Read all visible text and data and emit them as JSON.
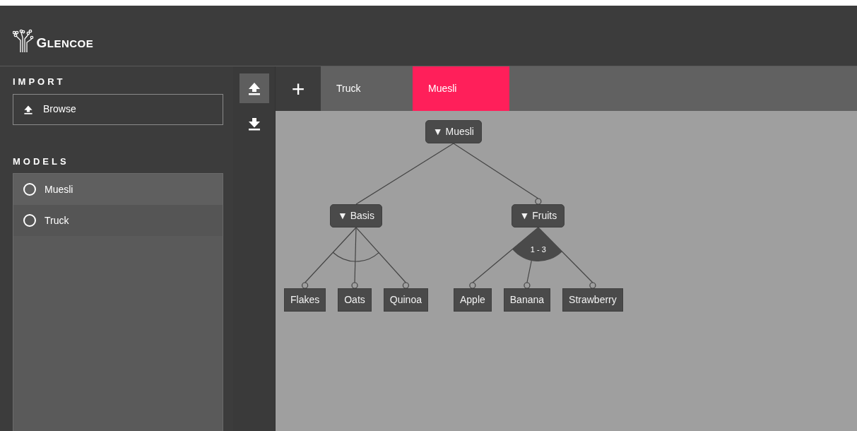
{
  "header": {
    "logo_text": "GLENCOE"
  },
  "sidebar": {
    "import_title": "IMPORT",
    "browse_button": "Browse",
    "models_title": "MODELS",
    "models": [
      {
        "name": "Muesli",
        "selected": false
      },
      {
        "name": "Truck",
        "selected": false
      }
    ]
  },
  "toolbar": [
    {
      "kind": "upload",
      "selected": true
    },
    {
      "kind": "download",
      "selected": false
    }
  ],
  "tabs": {
    "add_button": "+",
    "items": [
      {
        "label": "Truck",
        "selected": false
      },
      {
        "label": "Muesli",
        "selected": true
      }
    ]
  },
  "tree": {
    "name": "Muesli",
    "toggle": "▼",
    "optional": false,
    "kind": "and",
    "children": [
      {
        "name": "Basis",
        "toggle": "▼",
        "optional": false,
        "kind": "alternative",
        "children": [
          {
            "name": "Flakes",
            "optional": true
          },
          {
            "name": "Oats",
            "optional": true
          },
          {
            "name": "Quinoa",
            "optional": true
          }
        ]
      },
      {
        "name": "Fruits",
        "toggle": "▼",
        "optional": true,
        "kind": "or",
        "cardinality": "1 - 3",
        "children": [
          {
            "name": "Apple",
            "optional": true
          },
          {
            "name": "Banana",
            "optional": true
          },
          {
            "name": "Strawberry",
            "optional": true
          }
        ]
      }
    ]
  }
}
